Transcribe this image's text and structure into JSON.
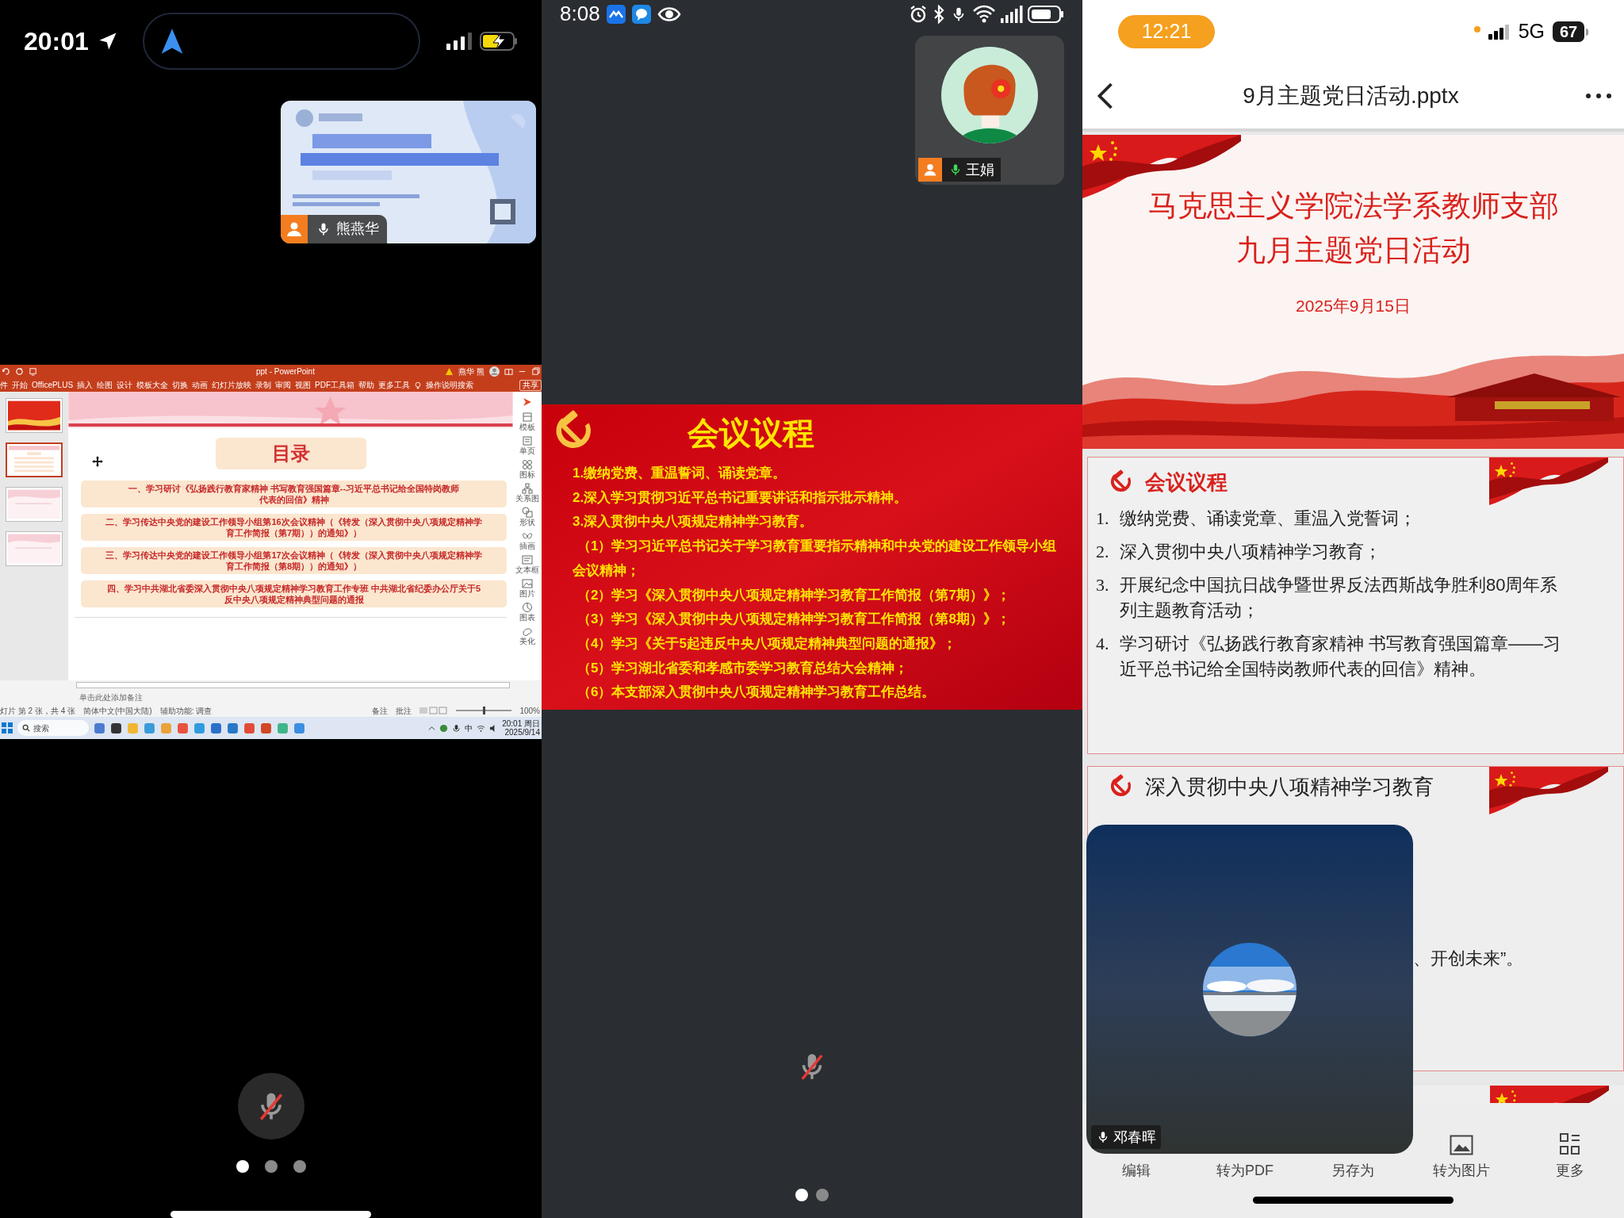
{
  "left_phone": {
    "status_bar": {
      "time": "20:01"
    },
    "screen_share_tile": {
      "kind": "picture",
      "participant": "熊燕华"
    },
    "powerpoint": {
      "title": "ppt - PowerPoint",
      "account": "燕华 熊",
      "ribbon_tabs": [
        "件",
        "开始",
        "OfficePLUS",
        "插入",
        "绘图",
        "设计",
        "模板大全",
        "切换",
        "动画",
        "幻灯片放映",
        "录制",
        "审阅",
        "视图",
        "PDF工具箱",
        "帮助",
        "更多工具",
        "操作说明搜索"
      ],
      "share_button": "共享",
      "thumbnails": [
        {
          "selected": false
        },
        {
          "selected": true
        },
        {
          "selected": false
        },
        {
          "selected": false
        }
      ],
      "slide": {
        "heading": "目录",
        "entries": [
          {
            "lines": [
              "一、学习研讨《弘扬践行教育家精神 书写教育强国篇章--习近平总书记给全国特岗教师",
              "代表的回信》精神"
            ]
          },
          {
            "lines": [
              "二、学习传达中央党的建设工作领导小组第16次会议精神（《转发（深入贯彻中央八项规定精神学",
              "育工作简报（第7期））的通知》）"
            ]
          },
          {
            "lines": [
              "三、学习传达中央党的建设工作领导小组第17次会议精神（《转发（深入贯彻中央八项规定精神学",
              "育工作简报（第8期））的通知》）"
            ]
          },
          {
            "lines": [
              "四、学习中共湖北省委深入贯彻中央八项规定精神学习教育工作专班 中共湖北省纪委办公厅关于5",
              "反中央八项规定精神典型问题的通报"
            ]
          }
        ]
      },
      "side_tools": [
        "模板",
        "单页",
        "图标",
        "关系图",
        "形状",
        "插画",
        "文本框",
        "图片",
        "图表",
        "美化"
      ],
      "notes_text": "单击此处添加备注",
      "status_bar": {
        "slide_info": "灯片 第 2 张，共 4 张",
        "language": "简体中文(中国大陆)",
        "accessibility": "辅助功能: 调查",
        "notes": "备注",
        "comments": "批注",
        "zoom_slider": {
          "level": 0.5
        },
        "zoom": "100%"
      },
      "taskbar": {
        "search": "搜索",
        "input_method": "中",
        "clock": "20:01 周日",
        "date": "2025/9/14"
      }
    },
    "mic": {
      "muted": true
    },
    "page_dots": [
      {
        "selected": true
      },
      {
        "selected": false
      },
      {
        "selected": false
      }
    ]
  },
  "middle_phone": {
    "status_bar": {
      "time": "8:08"
    },
    "participant": {
      "name": "王娟"
    },
    "slide": {
      "title": "会议议程",
      "lines": [
        {
          "kind": "item",
          "lines": [
            "1.缴纳党费、重温誓词、诵读党章。"
          ]
        },
        {
          "kind": "item",
          "lines": [
            "2.深入学习贯彻习近平总书记重要讲话和指示批示精神。"
          ]
        },
        {
          "kind": "item",
          "lines": [
            "3.深入贯彻中央八项规定精神学习教育。"
          ]
        },
        {
          "kind": "subitem",
          "lines": [
            "（1）学习习近平总书记关于学习教育重要指示精神和中央党的建设工作领导小组",
            "会议精神；"
          ]
        },
        {
          "kind": "subitem",
          "lines": [
            "（2）学习《深入贯彻中央八项规定精神学习教育工作简报（第7期）》；"
          ]
        },
        {
          "kind": "subitem",
          "lines": [
            "（3）学习《深入贯彻中央八项规定精神学习教育工作简报（第8期）》；"
          ]
        },
        {
          "kind": "subitem",
          "lines": [
            "（4）学习《关于5起违反中央八项规定精神典型问题的通报》；"
          ]
        },
        {
          "kind": "subitem",
          "lines": [
            "（5）学习湖北省委和孝感市委学习教育总结大会精神；"
          ]
        },
        {
          "kind": "subitem",
          "lines": [
            "（6）本支部深入贯彻中央八项规定精神学习教育工作总结。"
          ]
        }
      ]
    },
    "mic": {
      "muted": true
    },
    "page_dots": [
      {
        "selected": true
      },
      {
        "selected": false
      }
    ]
  },
  "right_phone": {
    "status_bar": {
      "time": "12:21",
      "network": "5G",
      "battery": "67"
    },
    "title": "9月主题党日活动.pptx",
    "slides": [
      {
        "kind": "cover",
        "title_lines": [
          "马克思主义学院法学系教师支部",
          "九月主题党日活动"
        ],
        "date": "2025年9月15日"
      },
      {
        "kind": "agenda",
        "heading": "会议议程",
        "items": [
          {
            "number": "1.",
            "lines": [
              "缴纳党费、诵读党章、重温入党誓词；"
            ]
          },
          {
            "number": "2.",
            "lines": [
              "深入贯彻中央八项精神学习教育；"
            ]
          },
          {
            "number": "3.",
            "lines": [
              "开展纪念中国抗日战争暨世界反法西斯战争胜利80周年系",
              "列主题教育活动；"
            ]
          },
          {
            "number": "4.",
            "lines": [
              "学习研讨《弘扬践行教育家精神 书写教育强国篇章——习",
              "近平总书记给全国特岗教师代表的回信》精神。"
            ]
          }
        ]
      },
      {
        "kind": "section",
        "heading": "深入贯彻中央八项精神学习教育",
        "text": "、开创未来”。"
      }
    ],
    "video_tile": {
      "participant": "邓春晖"
    },
    "toolbar": [
      {
        "label": "编辑"
      },
      {
        "label": "转为PDF"
      },
      {
        "label": "另存为"
      },
      {
        "label": "转为图片"
      },
      {
        "label": "更多"
      }
    ]
  }
}
